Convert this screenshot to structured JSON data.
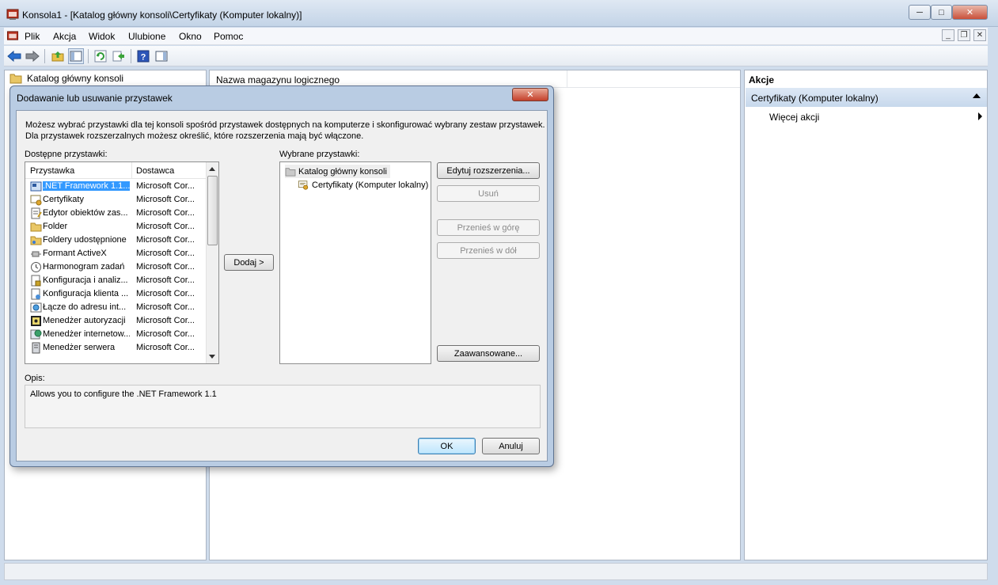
{
  "window": {
    "title": "Konsola1 - [Katalog główny konsoli\\Certyfikaty (Komputer lokalny)]"
  },
  "menubar": {
    "items": [
      "Plik",
      "Akcja",
      "Widok",
      "Ulubione",
      "Okno",
      "Pomoc"
    ]
  },
  "tree": {
    "root_label": "Katalog główny konsoli"
  },
  "center": {
    "column_header": "Nazwa magazynu logicznego"
  },
  "actions": {
    "title": "Akcje",
    "selected_label": "Certyfikaty (Komputer lokalny)",
    "more_label": "Więcej akcji"
  },
  "dialog": {
    "title": "Dodawanie lub usuwanie przystawek",
    "close_glyph": "✕",
    "description": "Możesz wybrać przystawki dla tej konsoli spośród przystawek dostępnych na komputerze i skonfigurować wybrany zestaw przystawek. Dla przystawek rozszerzalnych możesz określić, które rozszerzenia mają być włączone.",
    "available_label": "Dostępne przystawki:",
    "selected_label": "Wybrane przystawki:",
    "col_snapin": "Przystawka",
    "col_vendor": "Dostawca",
    "available_items": [
      {
        "name": ".NET Framework 1.1...",
        "vendor": "Microsoft Cor...",
        "icon": "net-framework-icon",
        "selected": true
      },
      {
        "name": "Certyfikaty",
        "vendor": "Microsoft Cor...",
        "icon": "certificate-icon"
      },
      {
        "name": "Edytor obiektów zas...",
        "vendor": "Microsoft Cor...",
        "icon": "policy-editor-icon"
      },
      {
        "name": "Folder",
        "vendor": "Microsoft Cor...",
        "icon": "folder-icon"
      },
      {
        "name": "Foldery udostępnione",
        "vendor": "Microsoft Cor...",
        "icon": "shared-folder-icon"
      },
      {
        "name": "Formant ActiveX",
        "vendor": "Microsoft Cor...",
        "icon": "activex-icon"
      },
      {
        "name": "Harmonogram zadań",
        "vendor": "Microsoft Cor...",
        "icon": "clock-icon"
      },
      {
        "name": "Konfiguracja i analiz...",
        "vendor": "Microsoft Cor...",
        "icon": "security-config-icon"
      },
      {
        "name": "Konfiguracja klienta ...",
        "vendor": "Microsoft Cor...",
        "icon": "client-config-icon"
      },
      {
        "name": "Łącze do adresu int...",
        "vendor": "Microsoft Cor...",
        "icon": "web-link-icon"
      },
      {
        "name": "Menedżer autoryzacji",
        "vendor": "Microsoft Cor...",
        "icon": "authorization-icon"
      },
      {
        "name": "Menedżer internetow...",
        "vendor": "Microsoft Cor...",
        "icon": "iis-icon"
      },
      {
        "name": "Menedżer serwera",
        "vendor": "Microsoft Cor...",
        "icon": "server-icon"
      }
    ],
    "add_button": "Dodaj >",
    "selected_tree": {
      "root": "Katalog główny konsoli",
      "child": "Certyfikaty (Komputer lokalny)"
    },
    "edit_extensions_button": "Edytuj rozszerzenia...",
    "remove_button": "Usuń",
    "move_up_button": "Przenieś w górę",
    "move_down_button": "Przenieś w dół",
    "advanced_button": "Zaawansowane...",
    "description_label": "Opis:",
    "description_text": "Allows you to configure the .NET Framework 1.1",
    "ok_button": "OK",
    "cancel_button": "Anuluj"
  },
  "colors": {
    "selection": "#3399ff",
    "actions_header": "#c7d8ec",
    "close_red": "#c4402b"
  }
}
